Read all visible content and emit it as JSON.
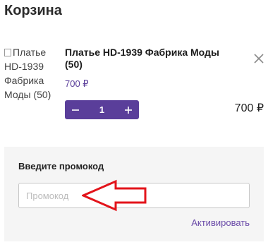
{
  "header": {
    "title": "Корзина"
  },
  "cart_item": {
    "image_alt": "Платье HD-1939 Фабрика Моды (50)",
    "name": "Платье HD-1939 Фабрика Моды (50)",
    "unit_price": "700 ₽",
    "quantity": "1",
    "minus_icon": "minus-icon",
    "plus_icon": "plus-icon",
    "remove_icon": "close-icon",
    "total": "700 ₽"
  },
  "promo": {
    "label": "Введите промокод",
    "placeholder": "Промокод",
    "value": "",
    "activate_label": "Активировать"
  },
  "colors": {
    "accent": "#5a3e9a",
    "link": "#6a4aa8",
    "annotation_arrow": "#e3141b",
    "panel_bg": "#f5f5f5"
  }
}
